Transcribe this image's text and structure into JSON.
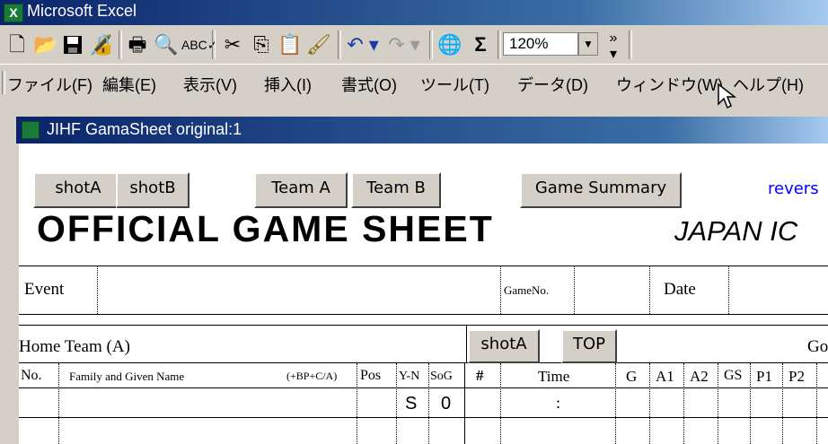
{
  "app": {
    "title": "Microsoft Excel"
  },
  "toolbar": {
    "zoom": "120%",
    "zoom_arrow": "▼",
    "more": "»",
    "icons": [
      "new-icon",
      "open-icon",
      "save-icon",
      "permission-icon",
      "print-icon",
      "print-preview-icon",
      "spelling-icon",
      "cut-icon",
      "copy-icon",
      "paste-icon",
      "format-painter-icon",
      "undo-icon",
      "redo-icon",
      "hyperlink-icon",
      "autosum-icon"
    ]
  },
  "menu": [
    "ファイル(F)",
    "編集(E)",
    "表示(V)",
    "挿入(I)",
    "書式(O)",
    "ツール(T)",
    "データ(D)",
    "ウィンドウ(W)",
    "ヘルプ(H)"
  ],
  "workbook": {
    "title": "JIHF GamaSheet original:1"
  },
  "sheet": {
    "buttons": {
      "shotA": "shotA",
      "shotB": "shotB",
      "teamA": "Team A",
      "teamB": "Team B",
      "summary": "Game Summary",
      "reverse": "revers",
      "shotA2": "shotA",
      "top": "TOP"
    },
    "title": "OFFICIAL GAME SHEET",
    "subtitle": "JAPAN IC",
    "event_label": "Event",
    "gameno_label": "GameNo.",
    "date_label": "Date",
    "home_team_label": "Home Team (A)",
    "go_fragment": "Go",
    "columns": {
      "no": "No.",
      "name": "Family and Given Name",
      "bp": "(+BP+C/A)",
      "pos": "Pos",
      "yn": "Y-N",
      "sog": "SoG",
      "num": "#",
      "time": "Time",
      "g": "G",
      "a1": "A1",
      "a2": "A2",
      "gs": "GS",
      "p1": "P1",
      "p2": "P2"
    },
    "row1": {
      "yn": "S",
      "sog": "0",
      "time": ":"
    }
  }
}
